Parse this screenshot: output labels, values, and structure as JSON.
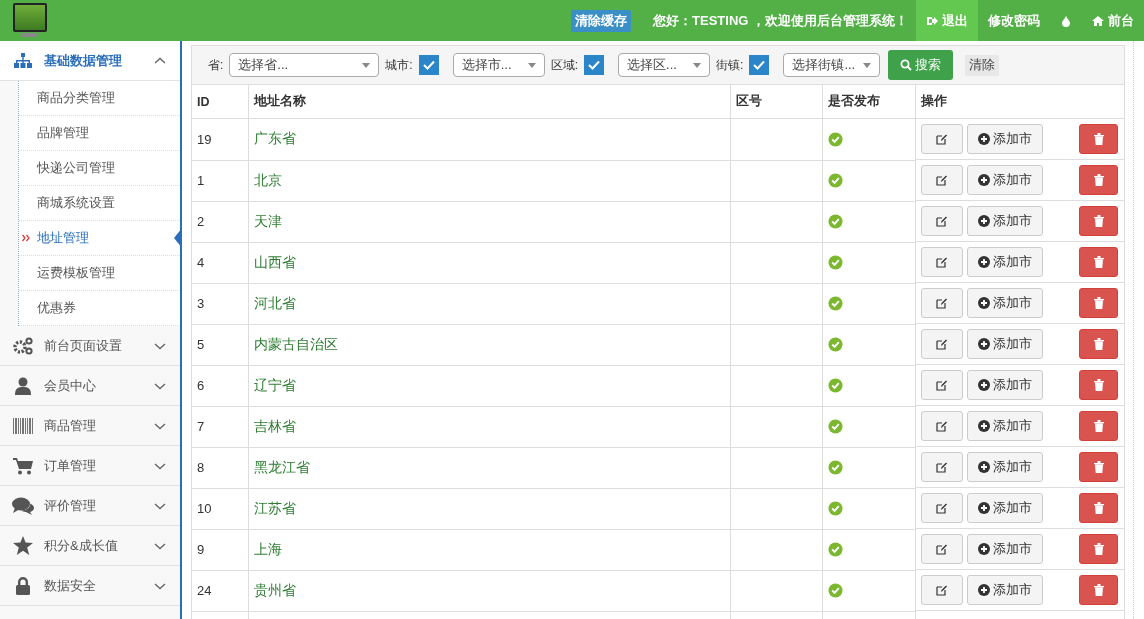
{
  "header": {
    "clear_cache": "清除缓存",
    "greeting": "您好：TESTING ，欢迎使用后台管理系统！",
    "nav": [
      {
        "label": "退出",
        "selected": true
      },
      {
        "label": "修改密码",
        "selected": false
      },
      {
        "selected": false
      },
      {
        "label": "前台",
        "selected": false
      }
    ]
  },
  "sidebar": {
    "groups": [
      {
        "label": "基础数据管理",
        "expanded": true,
        "children": [
          {
            "label": "商品分类管理",
            "selected": false
          },
          {
            "label": "品牌管理",
            "selected": false
          },
          {
            "label": "快递公司管理",
            "selected": false
          },
          {
            "label": "商城系统设置",
            "selected": false
          },
          {
            "label": "地址管理",
            "selected": true
          },
          {
            "label": "运费模板管理",
            "selected": false
          },
          {
            "label": "优惠券",
            "selected": false
          }
        ]
      },
      {
        "label": "前台页面设置",
        "expanded": false
      },
      {
        "label": "会员中心",
        "expanded": false
      },
      {
        "label": "商品管理",
        "expanded": false
      },
      {
        "label": "订单管理",
        "expanded": false
      },
      {
        "label": "评价管理",
        "expanded": false
      },
      {
        "label": "积分&成长值",
        "expanded": false
      },
      {
        "label": "数据安全",
        "expanded": false
      }
    ]
  },
  "filters": [
    {
      "label": "省:",
      "placeholder": "选择省..."
    },
    {
      "label": "城市:",
      "checked": true,
      "placeholder": "选择市..."
    },
    {
      "label": "区域:",
      "checked": true,
      "placeholder": "选择区..."
    },
    {
      "label": "街镇:",
      "checked": true,
      "placeholder": "选择街镇..."
    }
  ],
  "search_button": "搜索",
  "clear_button": "清除",
  "table": {
    "columns": [
      "ID",
      "地址名称",
      "区号",
      "是否发布",
      "操作"
    ],
    "rows": [
      {
        "id": "19",
        "name": "广东省",
        "published": true,
        "add_label": "添加市"
      },
      {
        "id": "1",
        "name": "北京",
        "published": true,
        "add_label": "添加市"
      },
      {
        "id": "2",
        "name": "天津",
        "published": true,
        "add_label": "添加市"
      },
      {
        "id": "4",
        "name": "山西省",
        "published": true,
        "add_label": "添加市"
      },
      {
        "id": "3",
        "name": "河北省",
        "published": true,
        "add_label": "添加市"
      },
      {
        "id": "5",
        "name": "内蒙古自治区",
        "published": true,
        "add_label": "添加市"
      },
      {
        "id": "6",
        "name": "辽宁省",
        "published": true,
        "add_label": "添加市"
      },
      {
        "id": "7",
        "name": "吉林省",
        "published": true,
        "add_label": "添加市"
      },
      {
        "id": "8",
        "name": "黑龙江省",
        "published": true,
        "add_label": "添加市"
      },
      {
        "id": "10",
        "name": "江苏省",
        "published": true,
        "add_label": "添加市"
      },
      {
        "id": "9",
        "name": "上海",
        "published": true,
        "add_label": "添加市"
      },
      {
        "id": "24",
        "name": "贵州省",
        "published": true,
        "add_label": "添加市"
      }
    ]
  }
}
